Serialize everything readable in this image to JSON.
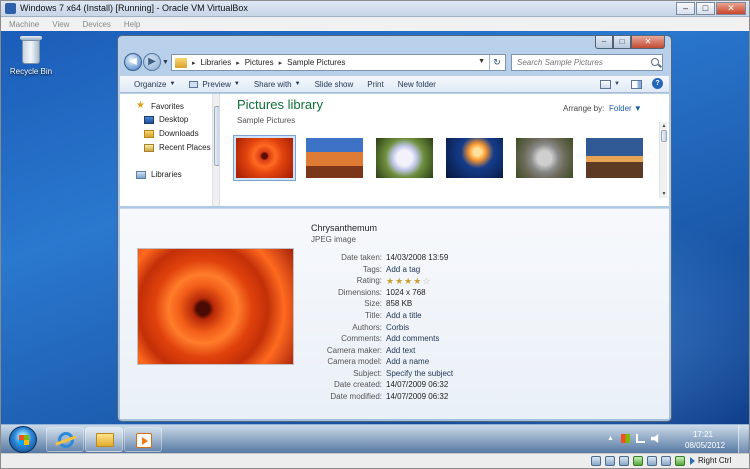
{
  "vbox": {
    "title": "Windows 7 x64 (Install) [Running] - Oracle VM VirtualBox",
    "menu": [
      "Machine",
      "View",
      "Devices",
      "Help"
    ],
    "hostkey": "Right Ctrl"
  },
  "desktop": {
    "recycle_label": "Recycle Bin"
  },
  "explorer": {
    "breadcrumb": [
      "Libraries",
      "Pictures",
      "Sample Pictures"
    ],
    "search_placeholder": "Search Sample Pictures",
    "toolbar": {
      "organize": "Organize",
      "preview": "Preview",
      "share": "Share with",
      "slideshow": "Slide show",
      "print": "Print",
      "newfolder": "New folder"
    },
    "navpane": {
      "favorites": "Favorites",
      "desktop": "Desktop",
      "downloads": "Downloads",
      "recent": "Recent Places",
      "libraries": "Libraries"
    },
    "library_title": "Pictures library",
    "library_subtitle": "Sample Pictures",
    "arrange_label": "Arrange by:",
    "arrange_value": "Folder",
    "thumbnails": [
      "Chrysanthemum",
      "Desert",
      "Hydrangeas",
      "Jellyfish",
      "Koala",
      "Lighthouse"
    ]
  },
  "details": {
    "name": "Chrysanthemum",
    "type": "JPEG image",
    "rating_stars": 4,
    "rows": [
      {
        "label": "Date taken:",
        "value": "14/03/2008 13:59"
      },
      {
        "label": "Tags:",
        "value": "Add a tag"
      },
      {
        "label": "Rating:",
        "value": ""
      },
      {
        "label": "Dimensions:",
        "value": "1024 x 768"
      },
      {
        "label": "Size:",
        "value": "858 KB"
      },
      {
        "label": "Title:",
        "value": "Add a title"
      },
      {
        "label": "Authors:",
        "value": "Corbis"
      },
      {
        "label": "Comments:",
        "value": "Add comments"
      },
      {
        "label": "Camera maker:",
        "value": "Add text"
      },
      {
        "label": "Camera model:",
        "value": "Add a name"
      },
      {
        "label": "Subject:",
        "value": "Specify the subject"
      },
      {
        "label": "Date created:",
        "value": "14/07/2009 06:32"
      },
      {
        "label": "Date modified:",
        "value": "14/07/2009 06:32"
      }
    ]
  },
  "taskbar": {
    "time": "17:21",
    "date": "08/05/2012"
  }
}
